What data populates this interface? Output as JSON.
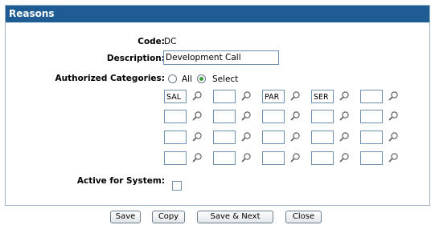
{
  "panel": {
    "title": "Reasons"
  },
  "form": {
    "code_label": "Code:",
    "code_value": "DC",
    "description_label": "Description:",
    "description_value": "Development Call",
    "categories_label": "Authorized Categories:",
    "radio_all_label": "All",
    "radio_select_label": "Select",
    "selected_radio": "Select",
    "categories": [
      [
        "SAL",
        "",
        "PAR",
        "SER",
        ""
      ],
      [
        "",
        "",
        "",
        "",
        ""
      ],
      [
        "",
        "",
        "",
        "",
        ""
      ],
      [
        "",
        "",
        "",
        "",
        ""
      ]
    ],
    "active_label": "Active for System:",
    "active_checked": false
  },
  "buttons": {
    "save": "Save",
    "copy": "Copy",
    "save_next": "Save & Next",
    "close": "Close"
  },
  "colors": {
    "title_bg": "#1f5c93",
    "radio_selected": "#3a9c3a"
  }
}
